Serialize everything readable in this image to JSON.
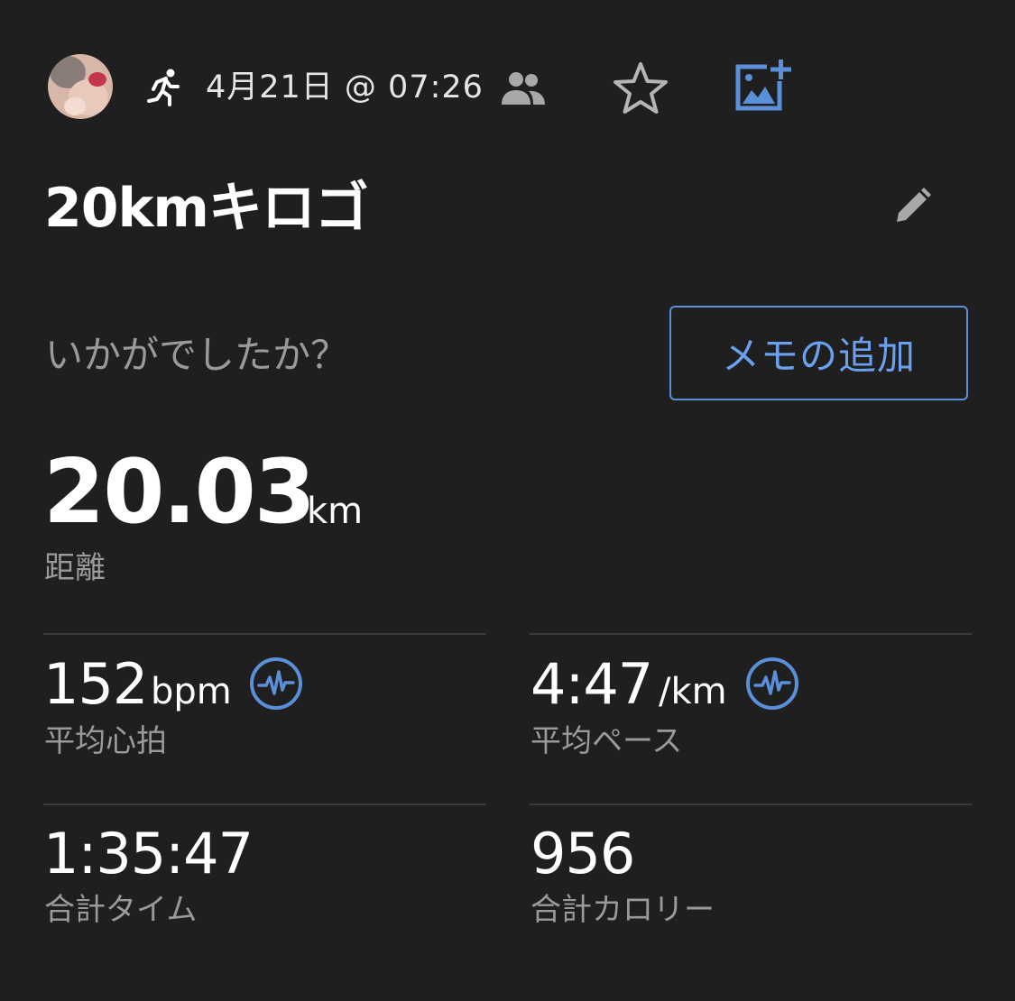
{
  "header": {
    "avatar_icon": "user-avatar",
    "activity_icon": "running-icon",
    "date_time": "4月21日 @ 07:26",
    "people_icon": "people-icon",
    "favorite_icon": "star-outline-icon",
    "add_photo_icon": "add-photo-icon"
  },
  "activity": {
    "title": "20kmキロゴ",
    "edit_icon": "pencil-icon"
  },
  "feeling": {
    "prompt": "いかがでしたか？",
    "memo_button_label": "メモの追加"
  },
  "distance": {
    "value": "20.03",
    "unit": "km",
    "label": "距離"
  },
  "stats": {
    "heart_rate": {
      "value": "152",
      "unit": "bpm",
      "label": "平均心拍",
      "icon": "activity-pulse-icon"
    },
    "pace": {
      "value": "4:47",
      "unit": "/km",
      "label": "平均ペース",
      "icon": "activity-pulse-icon"
    },
    "total_time": {
      "value": "1:35:47",
      "label": "合計タイム"
    },
    "calories": {
      "value": "956",
      "label": "合計カロリー"
    }
  },
  "colors": {
    "background": "#1f1f1f",
    "accent_blue": "#5b8fd8",
    "label_gray": "#9a9a9a",
    "divider": "#3a3a3a"
  }
}
